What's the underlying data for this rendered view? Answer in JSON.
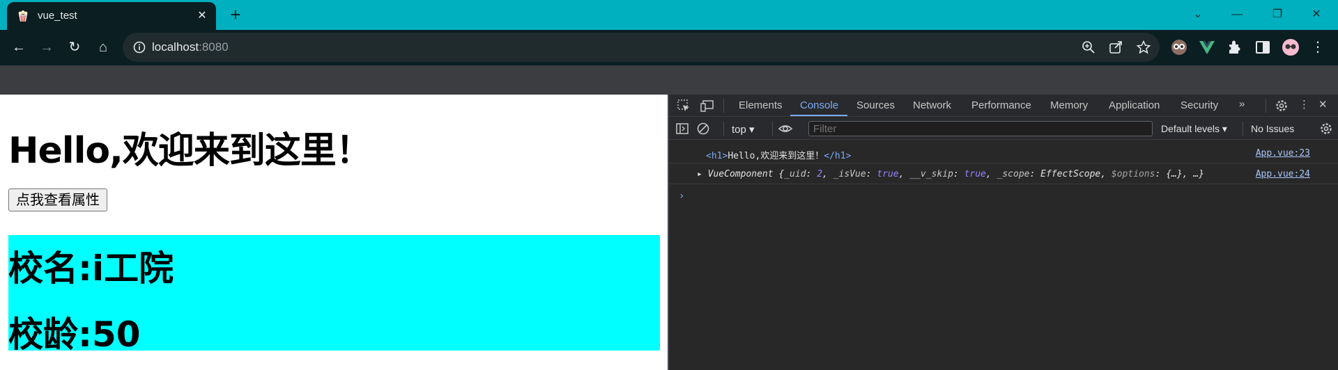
{
  "browser": {
    "tab_title": "vue_test",
    "new_tab": "+",
    "url_host": "localhost",
    "url_port": ":8080"
  },
  "page": {
    "heading": "Hello,欢迎来到这里！",
    "button_label": "点我查看属性",
    "school_name": "校名:i工院",
    "school_age": "校龄:50"
  },
  "devtools": {
    "tabs": [
      "Elements",
      "Console",
      "Sources",
      "Network",
      "Performance",
      "Memory",
      "Application",
      "Security"
    ],
    "active_tab": "Console",
    "context": "top",
    "filter_placeholder": "Filter",
    "levels": "Default levels",
    "issues": "No Issues",
    "console": [
      {
        "open_tag": "<h1>",
        "text": "Hello,欢迎来到这里！",
        "close_tag": "</h1>",
        "source": "App.vue:23"
      },
      {
        "prefix": "VueComponent",
        "body_open": "{",
        "k1": "_uid",
        "v1": "2",
        "k2": "_isVue",
        "v2": "true",
        "k3": "__v_skip",
        "v3": "true",
        "k4": "_scope",
        "v4": "EffectScope",
        "k5": "$options",
        "v5": "{…}",
        "tail": "…}",
        "source": "App.vue:24"
      }
    ],
    "prompt": "›"
  },
  "colors": {
    "tabstrip": "#00b0bf",
    "toolbar": "#0b1e21",
    "school_bg": "#00ffff",
    "devtools_bg": "#282828",
    "accent": "#7cacf8"
  }
}
